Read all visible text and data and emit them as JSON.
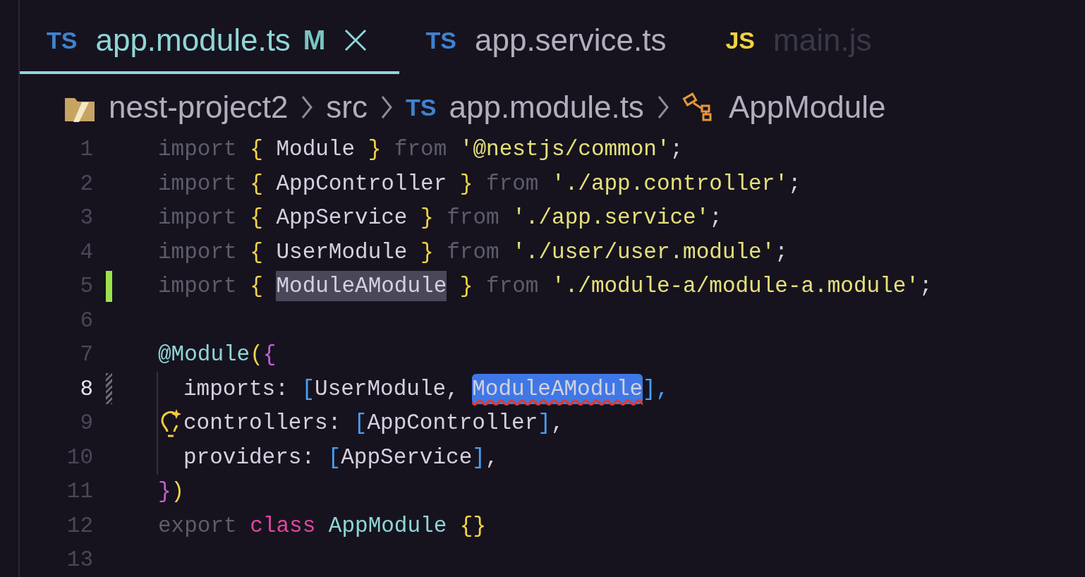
{
  "tabs": [
    {
      "badge": "TS",
      "kind": "ts",
      "label": "app.module.ts",
      "status": "M",
      "selected": true,
      "faded": false
    },
    {
      "badge": "TS",
      "kind": "ts",
      "label": "app.service.ts",
      "selected": false,
      "faded": false
    },
    {
      "badge": "JS",
      "kind": "js",
      "label": "main.js",
      "selected": false,
      "faded": true
    }
  ],
  "breadcrumb": [
    {
      "kind": "folder",
      "label": "nest-project2"
    },
    {
      "kind": "plain",
      "label": "src"
    },
    {
      "kind": "file",
      "badge": "TS",
      "label": "app.module.ts"
    },
    {
      "kind": "class",
      "label": "AppModule"
    }
  ],
  "lines": [
    {
      "number": "1",
      "current": false,
      "kind": "plain",
      "indented": false,
      "hint": false,
      "tokens": [
        {
          "text": "import",
          "kind": "keyword"
        },
        {
          "text": "{",
          "kind": "brace"
        },
        {
          "text": "Module",
          "kind": "ident"
        },
        {
          "text": "}",
          "kind": "brace"
        },
        {
          "text": "from",
          "kind": "keyword"
        },
        {
          "text": "'@nestjs/common'",
          "kind": "string"
        },
        {
          "text": ";",
          "kind": "ident",
          "tight": true
        }
      ]
    },
    {
      "number": "2",
      "current": false,
      "kind": "plain",
      "indented": false,
      "hint": false,
      "tokens": [
        {
          "text": "import",
          "kind": "keyword"
        },
        {
          "text": "{",
          "kind": "brace"
        },
        {
          "text": "AppController",
          "kind": "ident"
        },
        {
          "text": "}",
          "kind": "brace"
        },
        {
          "text": "from",
          "kind": "keyword"
        },
        {
          "text": "'./app.controller'",
          "kind": "string"
        },
        {
          "text": ";",
          "kind": "ident",
          "tight": true
        }
      ]
    },
    {
      "number": "3",
      "current": false,
      "kind": "plain",
      "indented": false,
      "hint": false,
      "tokens": [
        {
          "text": "import",
          "kind": "keyword"
        },
        {
          "text": "{",
          "kind": "brace"
        },
        {
          "text": "AppService",
          "kind": "ident"
        },
        {
          "text": "}",
          "kind": "brace"
        },
        {
          "text": "from",
          "kind": "keyword"
        },
        {
          "text": "'./app.service'",
          "kind": "string"
        },
        {
          "text": ";",
          "kind": "ident",
          "tight": true
        }
      ]
    },
    {
      "number": "4",
      "current": false,
      "kind": "plain",
      "indented": false,
      "hint": false,
      "tokens": [
        {
          "text": "import",
          "kind": "keyword"
        },
        {
          "text": "{",
          "kind": "brace"
        },
        {
          "text": "UserModule",
          "kind": "ident"
        },
        {
          "text": "}",
          "kind": "brace"
        },
        {
          "text": "from",
          "kind": "keyword"
        },
        {
          "text": "'./user/user.module'",
          "kind": "string"
        },
        {
          "text": ";",
          "kind": "ident",
          "tight": true
        }
      ]
    },
    {
      "number": "5",
      "current": false,
      "kind": "added",
      "indented": false,
      "hint": false,
      "tokens": [
        {
          "text": "import",
          "kind": "keyword"
        },
        {
          "text": "{",
          "kind": "brace"
        },
        {
          "text": "ModuleAModule",
          "kind": "ident",
          "highlighted": true
        },
        {
          "text": "}",
          "kind": "brace"
        },
        {
          "text": "from",
          "kind": "keyword"
        },
        {
          "text": "'./module-a/module-a.module'",
          "kind": "string"
        },
        {
          "text": ";",
          "kind": "ident",
          "tight": true
        }
      ]
    },
    {
      "number": "6",
      "current": false,
      "kind": "plain",
      "indented": false,
      "hint": false
    },
    {
      "number": "7",
      "current": false,
      "kind": "plain",
      "indented": false,
      "hint": false,
      "tokens": [
        {
          "text": "@Module",
          "kind": "decorator"
        },
        {
          "text": "(",
          "kind": "paren",
          "tight": true
        },
        {
          "text": "{",
          "kind": "pink",
          "tight": true
        }
      ]
    },
    {
      "number": "8",
      "current": true,
      "kind": "modified",
      "indented": true,
      "hint": false,
      "tokens": [
        {
          "text": "imports:",
          "kind": "ident"
        },
        {
          "text": "[UserModule,",
          "kind": "list"
        },
        {
          "text": "ModuleAModule",
          "kind": "ident",
          "selected": true,
          "error": true
        },
        {
          "text": "],",
          "kind": "close",
          "tight": true
        }
      ]
    },
    {
      "number": "9",
      "current": false,
      "kind": "plain",
      "indented": true,
      "hint": true,
      "tokens": [
        {
          "text": "controllers:",
          "kind": "ident"
        },
        {
          "text": "[AppController],",
          "kind": "list"
        }
      ]
    },
    {
      "number": "10",
      "current": false,
      "kind": "plain",
      "indented": true,
      "hint": false,
      "tokens": [
        {
          "text": "providers:",
          "kind": "ident"
        },
        {
          "text": "[AppService],",
          "kind": "list"
        }
      ]
    },
    {
      "number": "11",
      "current": false,
      "kind": "plain",
      "indented": false,
      "hint": false,
      "tokens": [
        {
          "text": "}",
          "kind": "pink"
        },
        {
          "text": ")",
          "kind": "paren",
          "tight": true
        }
      ]
    },
    {
      "number": "12",
      "current": false,
      "kind": "plain",
      "indented": false,
      "hint": false,
      "tokens": [
        {
          "text": "export",
          "kind": "keyword"
        },
        {
          "text": "class",
          "kind": "class"
        },
        {
          "text": "AppModule",
          "kind": "type"
        },
        {
          "text": "{}",
          "kind": "brace"
        }
      ]
    },
    {
      "number": "13",
      "current": false,
      "kind": "plain",
      "indented": false,
      "hint": false
    }
  ]
}
